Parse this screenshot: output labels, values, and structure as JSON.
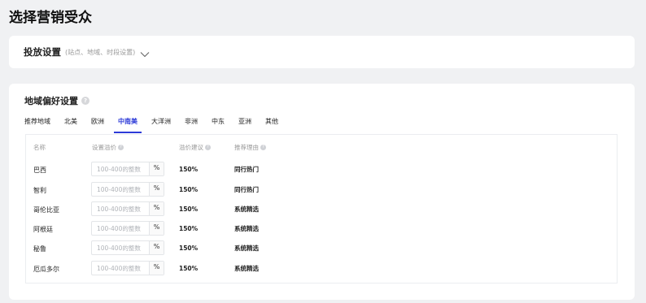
{
  "page": {
    "title": "选择营销受众"
  },
  "delivery": {
    "title": "投放设置",
    "subtitle": "(站点、地域、时段设置)",
    "toggle_icon": "chevron-down-icon"
  },
  "preference": {
    "title": "地域偏好设置",
    "help_icon": "question-circle-icon",
    "tabs": [
      {
        "label": "推荐地域",
        "active": false
      },
      {
        "label": "北美",
        "active": false
      },
      {
        "label": "欧洲",
        "active": false
      },
      {
        "label": "中南美",
        "active": true
      },
      {
        "label": "大洋洲",
        "active": false
      },
      {
        "label": "非洲",
        "active": false
      },
      {
        "label": "中东",
        "active": false
      },
      {
        "label": "亚洲",
        "active": false
      },
      {
        "label": "其他",
        "active": false
      }
    ],
    "columns": {
      "name": "名称",
      "price": "设置溢价",
      "suggestion": "溢价建议",
      "reason": "推荐理由"
    },
    "rows": [
      {
        "name": "巴西",
        "placeholder": "100-400的整数",
        "unit": "%",
        "suggestion": "150%",
        "reason": "同行热门"
      },
      {
        "name": "智利",
        "placeholder": "100-400的整数",
        "unit": "%",
        "suggestion": "150%",
        "reason": "同行热门"
      },
      {
        "name": "哥伦比亚",
        "placeholder": "100-400的整数",
        "unit": "%",
        "suggestion": "150%",
        "reason": "系统精选"
      },
      {
        "name": "阿根廷",
        "placeholder": "100-400的整数",
        "unit": "%",
        "suggestion": "150%",
        "reason": "系统精选"
      },
      {
        "name": "秘鲁",
        "placeholder": "100-400的整数",
        "unit": "%",
        "suggestion": "150%",
        "reason": "系统精选"
      },
      {
        "name": "厄瓜多尔",
        "placeholder": "100-400的整数",
        "unit": "%",
        "suggestion": "150%",
        "reason": "系统精选"
      }
    ]
  },
  "colors": {
    "accent": "#2d3bd8",
    "background": "#f0f1f3",
    "card": "#ffffff"
  }
}
